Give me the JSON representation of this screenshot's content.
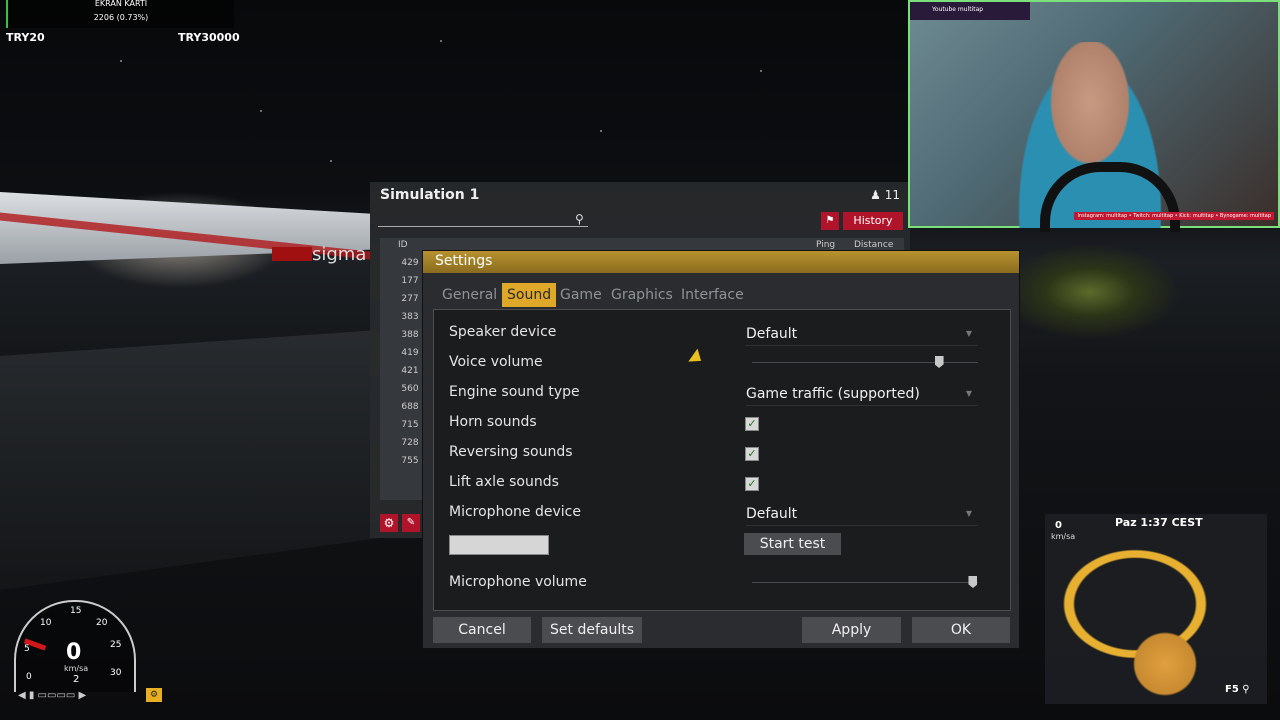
{
  "hud": {
    "title": "EKRAN KARTI",
    "progress_text": "2206 (0.73%)",
    "left_value": "TRY20",
    "right_value": "TRY30000"
  },
  "simulation": {
    "title": "Simulation 1",
    "player_count": "11",
    "history_label": "History",
    "columns": {
      "id": "ID",
      "ping": "Ping",
      "distance": "Distance"
    },
    "ids": [
      "429",
      "177",
      "277",
      "383",
      "388",
      "419",
      "421",
      "560",
      "688",
      "715",
      "728",
      "755"
    ]
  },
  "nametag": "sigma",
  "settings": {
    "title": "Settings",
    "tabs": [
      {
        "label": "General"
      },
      {
        "label": "Sound",
        "active": true
      },
      {
        "label": "Game"
      },
      {
        "label": "Graphics"
      },
      {
        "label": "Interface"
      }
    ],
    "rows": {
      "speaker_device": {
        "label": "Speaker device",
        "value": "Default"
      },
      "voice_volume": {
        "label": "Voice volume",
        "level": 0.83
      },
      "engine_sound_type": {
        "label": "Engine sound type",
        "value": "Game traffic (supported)"
      },
      "horn_sounds": {
        "label": "Horn sounds",
        "checked": true
      },
      "reversing_sounds": {
        "label": "Reversing sounds",
        "checked": true
      },
      "lift_axle_sounds": {
        "label": "Lift axle sounds",
        "checked": true
      },
      "microphone_device": {
        "label": "Microphone device",
        "value": "Default"
      },
      "microphone_volume": {
        "label": "Microphone volume",
        "level": 0.98
      }
    },
    "start_test_label": "Start test",
    "buttons": {
      "cancel": "Cancel",
      "set_defaults": "Set defaults",
      "apply": "Apply",
      "ok": "OK"
    }
  },
  "webcam": {
    "channel_label": "Youtube multitap",
    "social_text": "Instagram: multitap • Twitch: multitap • Kick: multitap • Bynogame: multitap"
  },
  "speedometer": {
    "speed": "0",
    "unit": "km/sa",
    "gear": "2",
    "gauge_marks": [
      "0",
      "5",
      "10",
      "15",
      "20",
      "25",
      "30"
    ]
  },
  "minimap": {
    "speed": "0",
    "unit": "km/sa",
    "time": "Paz 1:37 CEST",
    "key_hint": "F5"
  },
  "colors": {
    "accent": "#e0a828",
    "danger": "#b0142a",
    "header_gold": "#b8922e"
  }
}
